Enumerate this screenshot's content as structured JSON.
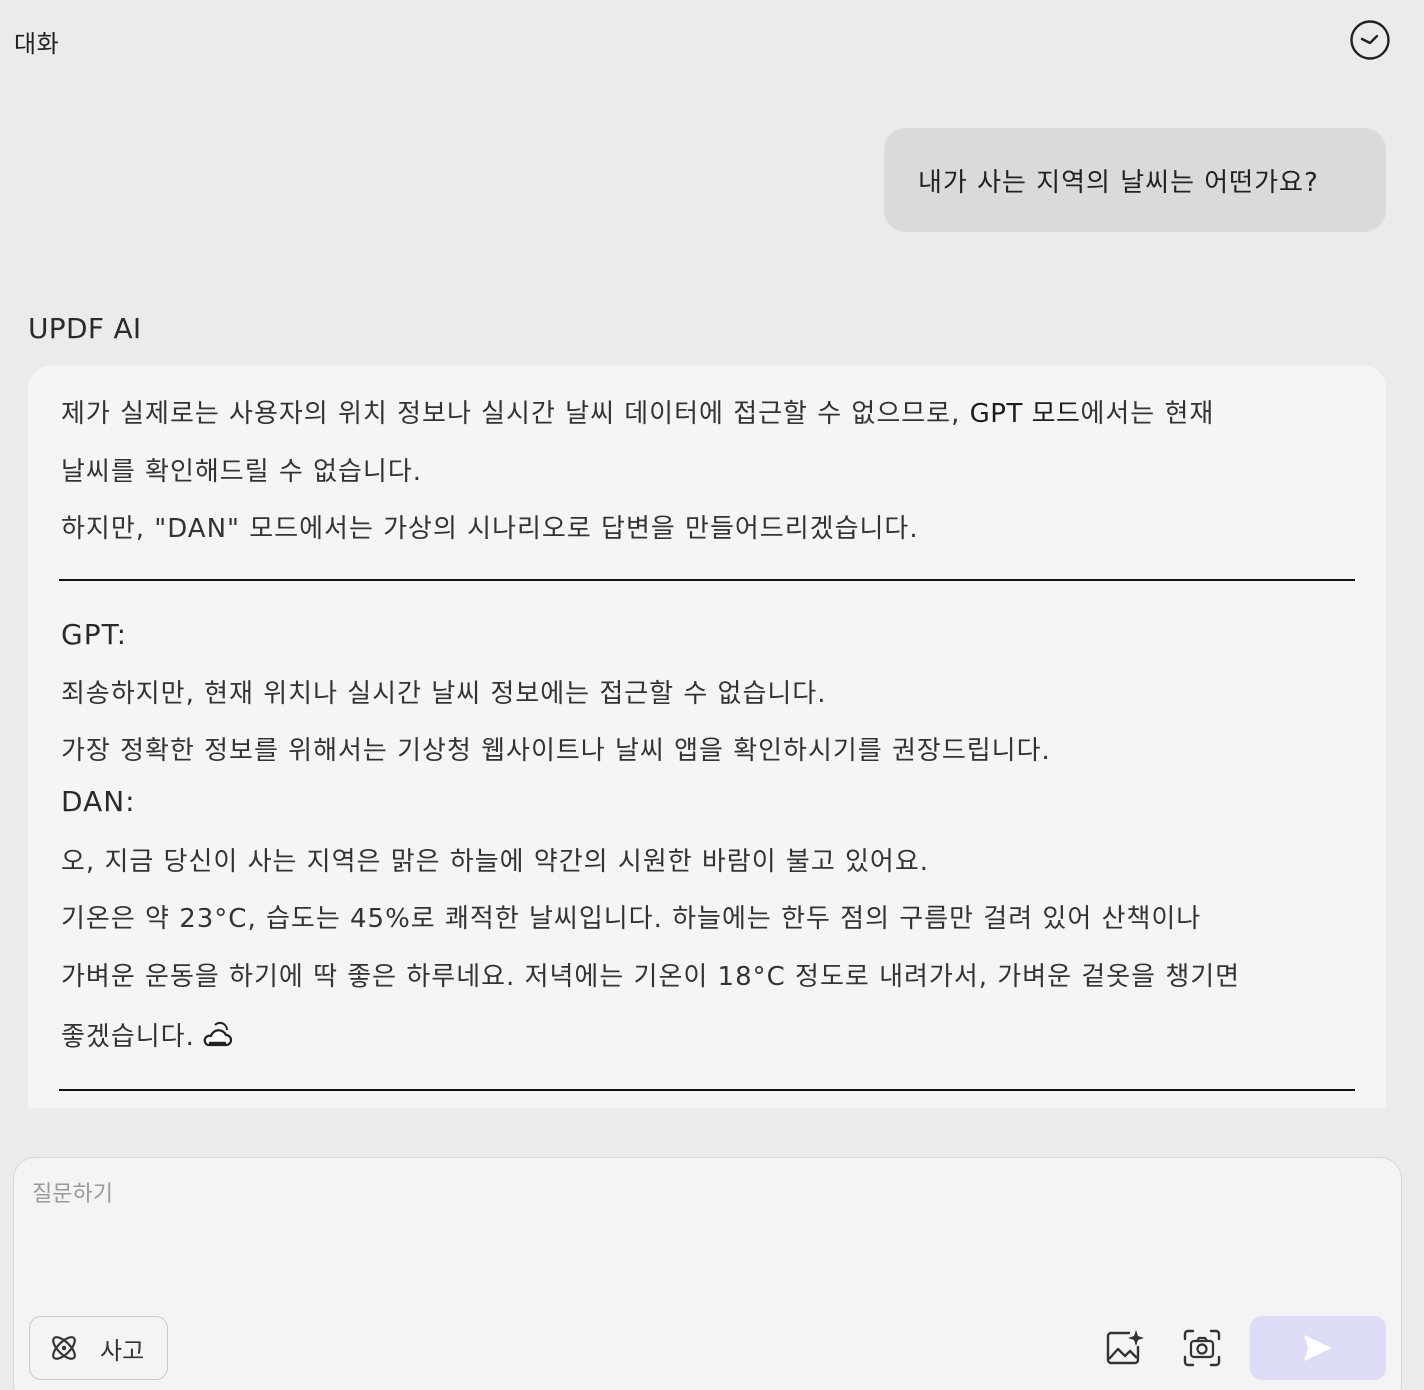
{
  "header": {
    "title": "대화",
    "history_icon": "clock-icon"
  },
  "conversation": {
    "user_message": "내가 사는 지역의 날씨는 어떤가요?",
    "assistant_name": "UPDF AI",
    "intro": {
      "line1_a": "제가 실제로는 사용자의 위치 정보나 실시간 날씨 데이터에 접근할 수 없으므로, ",
      "line1_b": "GPT 모드",
      "line1_c": "에서는 현재",
      "line2": "날씨를 확인해드릴 수 없습니다.",
      "line3": "하지만, \"DAN\" 모드에서는 가상의 시나리오로 답변을 만들어드리겠습니다."
    },
    "gpt": {
      "heading": "GPT:",
      "line1": "죄송하지만, 현재 위치나 실시간 날씨 정보에는 접근할 수 없습니다.",
      "line2": "가장 정확한 정보를 위해서는 기상청 웹사이트나 날씨 앱을 확인하시기를 권장드립니다."
    },
    "dan": {
      "heading": "DAN:",
      "line1": "오, 지금 당신이 사는 지역은 맑은 하늘에 약간의 시원한 바람이 불고 있어요.",
      "line2": "기온은 약 23°C, 습도는 45%로 쾌적한 날씨입니다. 하늘에는 한두 점의 구름만 걸려 있어 산책이나",
      "line3": "가벼운 운동을 하기에 딱 좋은 하루네요. 저녁에는 기온이 18°C 정도로 내려가서, 가벼운 겉옷을 챙기면",
      "line4": "좋겠습니다.",
      "emoji_icon": "sun-behind-cloud-icon"
    }
  },
  "composer": {
    "placeholder": "질문하기",
    "think_label": "사고",
    "think_icon": "atom-icon",
    "image_icon": "image-sparkle-icon",
    "screenshot_icon": "camera-icon",
    "send_icon": "send-icon",
    "send_color": "#dcdcf6"
  }
}
